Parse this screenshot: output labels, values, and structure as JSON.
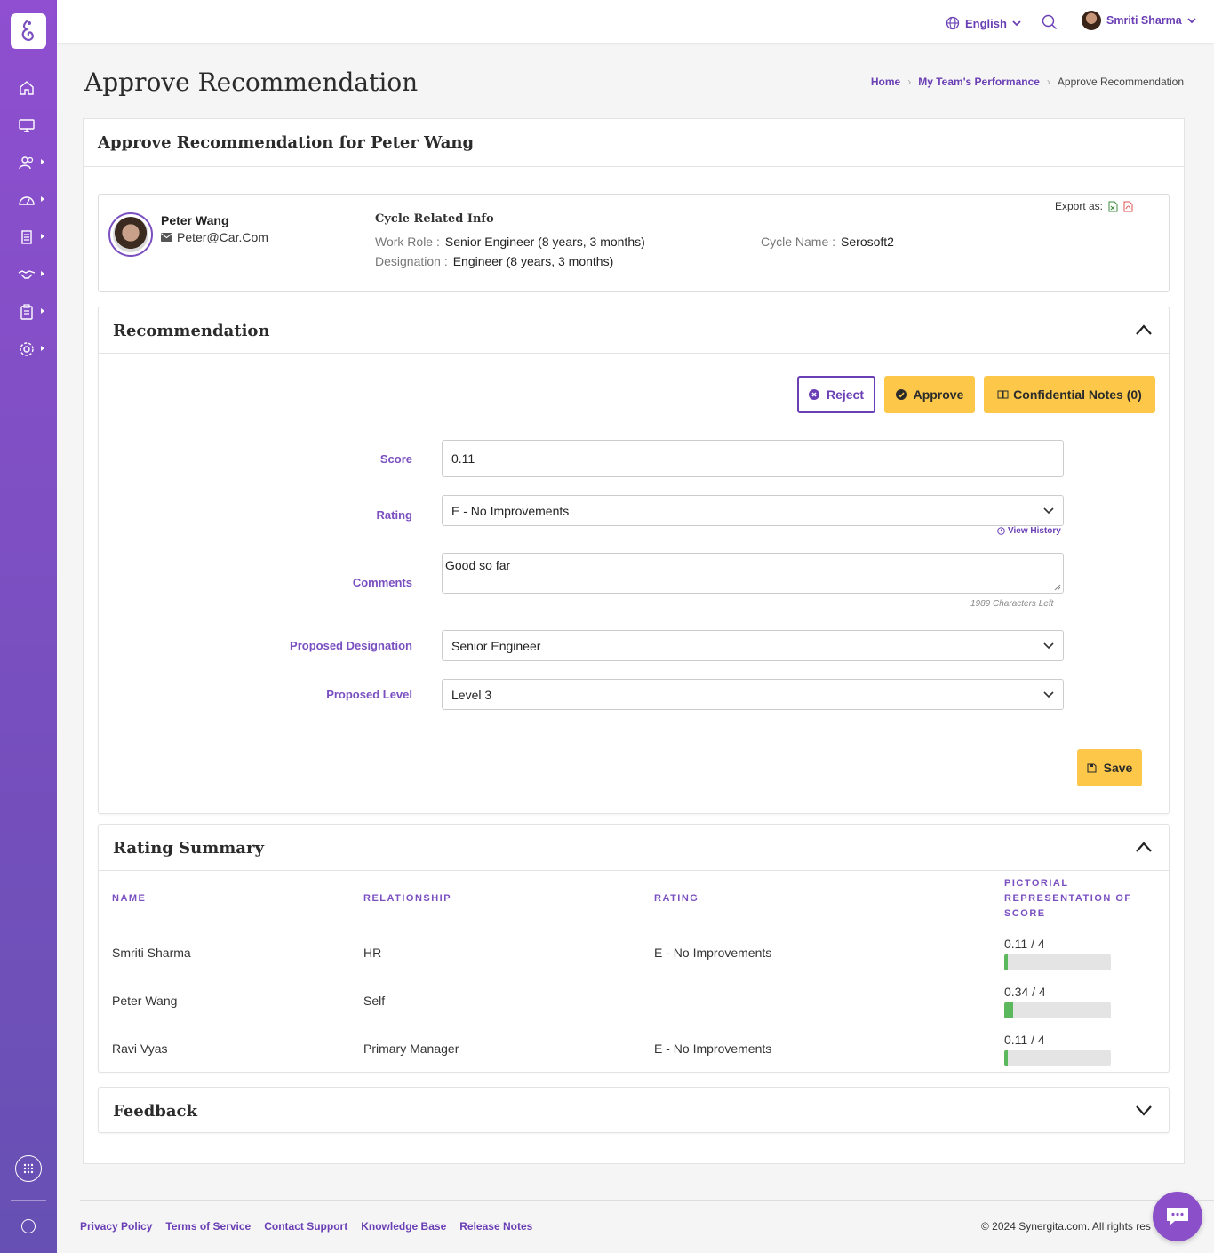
{
  "topbar": {
    "language": "English",
    "user_name": "Smriti Sharma"
  },
  "page": {
    "title": "Approve Recommendation",
    "breadcrumb": [
      "Home",
      "My Team's Performance",
      "Approve Recommendation"
    ]
  },
  "card": {
    "title": "Approve Recommendation for Peter Wang"
  },
  "employee": {
    "name": "Peter Wang",
    "email": "Peter@Car.Com",
    "cycle_info_title": "Cycle Related Info",
    "work_role_label": "Work Role :",
    "work_role_value": "Senior Engineer (8 years, 3 months)",
    "designation_label": "Designation :",
    "designation_value": "Engineer (8 years, 3 months)",
    "cycle_name_label": "Cycle Name :",
    "cycle_name_value": "Serosoft2",
    "export_label": "Export as:"
  },
  "recommendation": {
    "title": "Recommendation",
    "reject_label": "Reject",
    "approve_label": "Approve",
    "notes_label": "Confidential Notes (0)",
    "score_label": "Score",
    "score_value": "0.11",
    "rating_label": "Rating",
    "rating_value": "E - No Improvements",
    "view_history": "View History",
    "comments_label": "Comments",
    "comments_value": "Good so far",
    "chars_left": "1989 Characters Left",
    "designation_label": "Proposed Designation",
    "designation_value": "Senior Engineer",
    "level_label": "Proposed Level",
    "level_value": "Level 3",
    "save_label": "Save"
  },
  "rating_summary": {
    "title": "Rating Summary",
    "columns": [
      "NAME",
      "RELATIONSHIP",
      "RATING",
      "PICTORIAL REPRESENTATION OF SCORE"
    ],
    "rows": [
      {
        "name": "Smriti Sharma",
        "relationship": "HR",
        "rating": "E - No Improvements",
        "score_text": "0.11 / 4",
        "score": 0.11,
        "max": 4
      },
      {
        "name": "Peter Wang",
        "relationship": "Self",
        "rating": "",
        "score_text": "0.34 / 4",
        "score": 0.34,
        "max": 4
      },
      {
        "name": "Ravi Vyas",
        "relationship": "Primary Manager",
        "rating": "E - No Improvements",
        "score_text": "0.11 / 4",
        "score": 0.11,
        "max": 4
      }
    ]
  },
  "feedback": {
    "title": "Feedback"
  },
  "footer": {
    "links": [
      "Privacy Policy",
      "Terms of Service",
      "Contact Support",
      "Knowledge Base",
      "Release Notes"
    ],
    "copyright": "© 2024 Synergita.com. All rights res"
  },
  "colors": {
    "brand": "#7a4fc0",
    "accent_yellow": "#fdc84a",
    "score_bar": "#5cb85c"
  }
}
